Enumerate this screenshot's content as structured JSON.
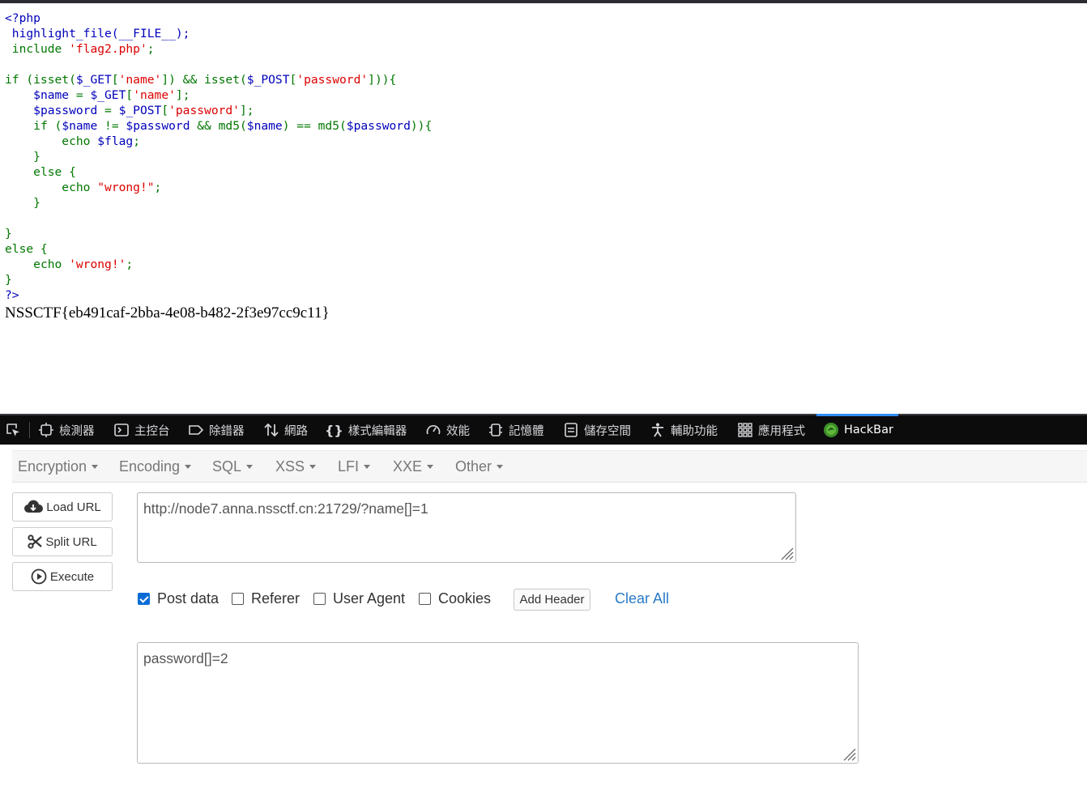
{
  "source": {
    "open_tag": "<?php",
    "close_tag": "?>",
    "highlight_call": "highlight_file(__FILE__);",
    "include_kw": "include",
    "include_file": "'flag2.php'",
    "semicolon": ";",
    "if_open_a": "if (isset(",
    "get_var": "$_GET",
    "post_var": "$_POST",
    "key_name": "'name'",
    "key_password": "'password'",
    "if_open_mid": "]) && isset(",
    "if_open_end": "])){",
    "name_var": "$name",
    "password_var": "$password",
    "assign": " = ",
    "bracket_open": "[",
    "bracket_close": "];",
    "inner_if_a": "if (",
    "inner_if_b": " != ",
    "inner_if_c": " && md5(",
    "inner_if_d": ") == md5(",
    "inner_if_e": ")){",
    "echo_kw": "echo",
    "flag_var": "$flag",
    "close_brace": "}",
    "else_open": "else {",
    "wrong_dq": "\"wrong!\"",
    "wrong_sq": "'wrong!'"
  },
  "flag_output": "NSSCTF{eb491caf-2bba-4e08-b482-2f3e97cc9c11}",
  "devtools": {
    "tabs": [
      {
        "label": "檢測器"
      },
      {
        "label": "主控台"
      },
      {
        "label": "除錯器"
      },
      {
        "label": "網路"
      },
      {
        "label": "樣式編輯器"
      },
      {
        "label": "效能"
      },
      {
        "label": "記憶體"
      },
      {
        "label": "儲存空間"
      },
      {
        "label": "輔助功能"
      },
      {
        "label": "應用程式"
      },
      {
        "label": "HackBar"
      }
    ],
    "active_tab": "HackBar",
    "accent_color": "#2e8bf5"
  },
  "hackbar": {
    "menu": [
      "Encryption",
      "Encoding",
      "SQL",
      "XSS",
      "LFI",
      "XXE",
      "Other"
    ],
    "buttons": {
      "load_url": "Load URL",
      "split_url": "Split URL",
      "execute": "Execute"
    },
    "url_value": "http://node7.anna.nssctf.cn:21729/?name[]=1",
    "options": {
      "post_data": {
        "label": "Post data",
        "checked": true
      },
      "referer": {
        "label": "Referer",
        "checked": false
      },
      "user_agent": {
        "label": "User Agent",
        "checked": false
      },
      "cookies": {
        "label": "Cookies",
        "checked": false
      }
    },
    "add_header": "Add Header",
    "clear_all": "Clear All",
    "post_value": "password[]=2"
  }
}
